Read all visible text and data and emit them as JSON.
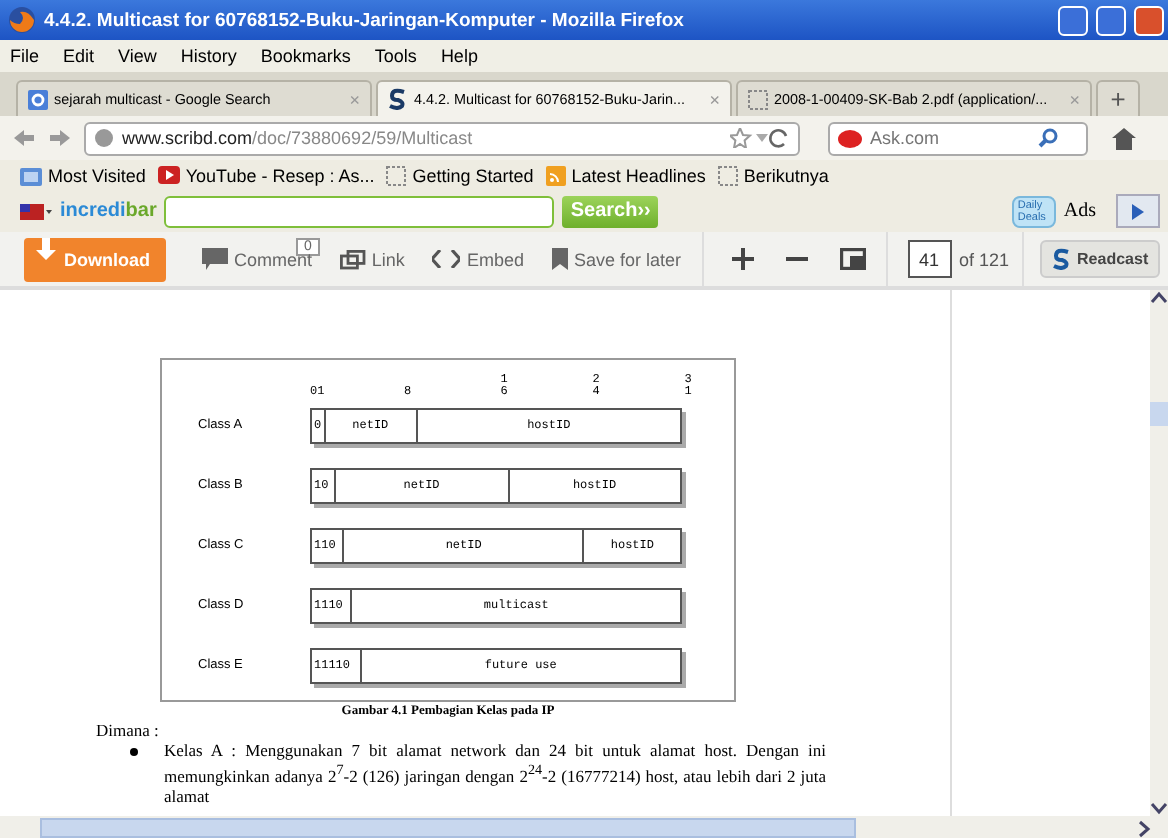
{
  "window": {
    "title": "4.4.2. Multicast for 60768152-Buku-Jaringan-Komputer - Mozilla Firefox"
  },
  "menu": [
    "File",
    "Edit",
    "View",
    "History",
    "Bookmarks",
    "Tools",
    "Help"
  ],
  "tabs": [
    {
      "label": "sejarah multicast - Google Search",
      "selected": false,
      "close": "×"
    },
    {
      "label": "4.4.2. Multicast for 60768152-Buku-Jarin...",
      "selected": true,
      "close": "×"
    },
    {
      "label": "2008-1-00409-SK-Bab 2.pdf (application/...",
      "selected": false,
      "close": "×"
    }
  ],
  "new_tab": "+",
  "address": {
    "host": "www.scribd.com",
    "path": "/doc/73880692/59/Multicast"
  },
  "search_engine": {
    "placeholder": "Ask.com"
  },
  "bookmarks": [
    "Most Visited",
    "YouTube - Resep : As...",
    "Getting Started",
    "Latest Headlines",
    "Berikutnya"
  ],
  "incredibar": {
    "brand_a": "incredi",
    "brand_b": "bar",
    "search_button": "Search››",
    "ads": "Ads",
    "deals": "Daily Deals"
  },
  "scribd_toolbar": {
    "download": "Download",
    "comment": "Comment",
    "comment_count": "0",
    "link": "Link",
    "embed": "Embed",
    "save": "Save for later",
    "page": "41",
    "of": "of 121",
    "readcast": "Readcast"
  },
  "figure": {
    "ticks": [
      {
        "label": "01",
        "kind": "inline"
      },
      {
        "label": "8",
        "kind": "inline"
      },
      {
        "label": "16",
        "kind": "stacked"
      },
      {
        "label": "24",
        "kind": "stacked"
      },
      {
        "label": "31",
        "kind": "stacked"
      }
    ],
    "rows": [
      {
        "label": "Class A",
        "fields": [
          "0",
          "netID",
          "hostID"
        ]
      },
      {
        "label": "Class B",
        "fields": [
          "10",
          "netID",
          "hostID"
        ]
      },
      {
        "label": "Class C",
        "fields": [
          "110",
          "netID",
          "hostID"
        ]
      },
      {
        "label": "Class D",
        "fields": [
          "1110",
          "multicast"
        ]
      },
      {
        "label": "Class E",
        "fields": [
          "11110",
          "future use"
        ]
      }
    ],
    "caption": "Gambar  4.1 Pembagian Kelas pada IP"
  },
  "body": {
    "intro": "Dimana :",
    "bullets": [
      "Kelas A : Menggunakan 7 bit alamat network dan 24 bit untuk alamat host. Dengan ini memungkinkan adanya 2$^{7}$-2 (126) jaringan dengan 2$^{24}$-2 (16777214) host, atau lebih dari 2 juta alamat"
    ]
  }
}
